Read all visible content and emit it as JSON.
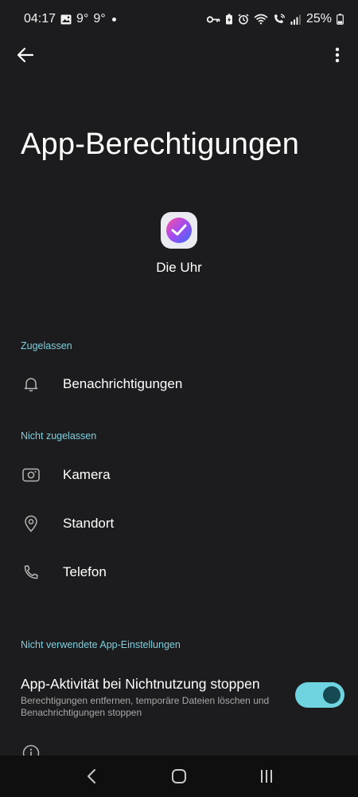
{
  "status_bar": {
    "time": "04:17",
    "temp1": "9°",
    "temp2": "9°",
    "battery": "25%"
  },
  "page": {
    "title": "App-Berechtigungen"
  },
  "app": {
    "name": "Die Uhr",
    "icon": "clock-app-icon"
  },
  "sections": {
    "allowed": {
      "header": "Zugelassen",
      "items": [
        {
          "label": "Benachrichtigungen",
          "icon": "bell-icon"
        }
      ]
    },
    "not_allowed": {
      "header": "Nicht zugelassen",
      "items": [
        {
          "label": "Kamera",
          "icon": "camera-icon"
        },
        {
          "label": "Standort",
          "icon": "location-pin-icon"
        },
        {
          "label": "Telefon",
          "icon": "phone-icon"
        }
      ]
    },
    "unused": {
      "header": "Nicht verwendete App-Einstellungen",
      "setting_title": "App-Aktivität bei Nichtnutzung stoppen",
      "setting_desc": "Berechtigungen entfernen, temporäre Dateien löschen und Benachrichtigungen stoppen",
      "toggle_on": true
    }
  },
  "colors": {
    "accent": "#7dd0de",
    "toggle_track": "#6fd3e0",
    "toggle_knob": "#164a52",
    "background": "#1c1c1e"
  }
}
